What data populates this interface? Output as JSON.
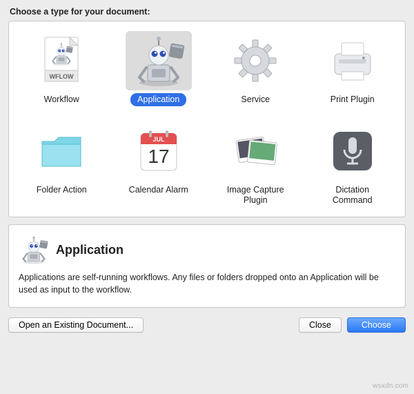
{
  "heading": "Choose a type for your document:",
  "types": [
    {
      "id": "workflow",
      "label": "Workflow",
      "icon": "workflow-icon",
      "selected": false
    },
    {
      "id": "application",
      "label": "Application",
      "icon": "application-icon",
      "selected": true
    },
    {
      "id": "service",
      "label": "Service",
      "icon": "service-icon",
      "selected": false
    },
    {
      "id": "print_plugin",
      "label": "Print Plugin",
      "icon": "print-plugin-icon",
      "selected": false
    },
    {
      "id": "folder_action",
      "label": "Folder Action",
      "icon": "folder-action-icon",
      "selected": false
    },
    {
      "id": "calendar_alarm",
      "label": "Calendar Alarm",
      "icon": "calendar-alarm-icon",
      "selected": false
    },
    {
      "id": "image_capture_plugin",
      "label": "Image Capture Plugin",
      "icon": "image-capture-plugin-icon",
      "selected": false
    },
    {
      "id": "dictation_command",
      "label": "Dictation Command",
      "icon": "dictation-command-icon",
      "selected": false
    }
  ],
  "description": {
    "title": "Application",
    "body": "Applications are self-running workflows. Any files or folders dropped onto an Application will be used as input to the workflow.",
    "icon": "application-icon"
  },
  "buttons": {
    "open_existing": "Open an Existing Document...",
    "close": "Close",
    "choose": "Choose"
  },
  "calendar_icon": {
    "month": "JUL",
    "day": "17"
  },
  "colors": {
    "selection_blue": "#2f6fe6",
    "primary_button": "#2a78f3"
  },
  "watermark": "wsxdn.com"
}
